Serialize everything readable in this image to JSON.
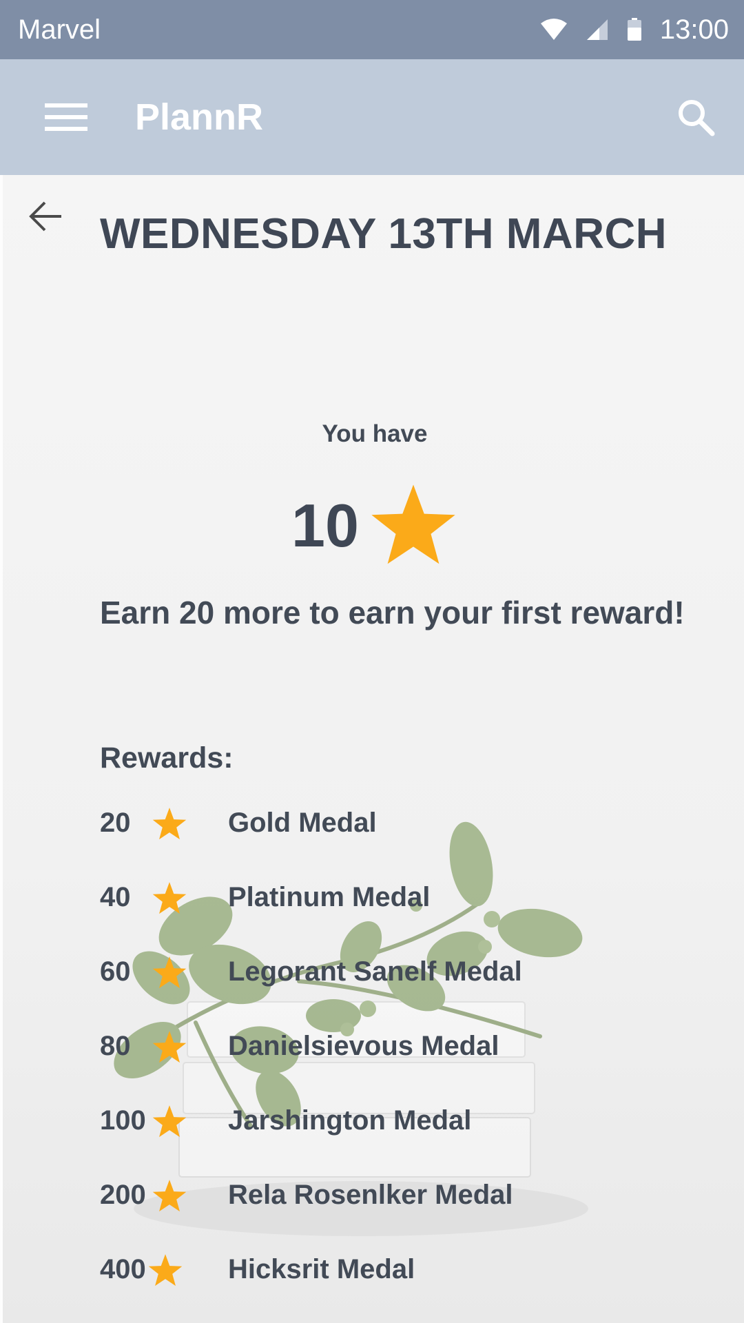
{
  "status_bar": {
    "carrier": "Marvel",
    "time": "13:00"
  },
  "app_bar": {
    "title": "PlannR",
    "menu_icon": "hamburger-menu-icon",
    "search_icon": "search-icon"
  },
  "page": {
    "back_icon": "arrow-back-icon",
    "title": "WEDNESDAY 13TH MARCH",
    "you_have": "You have",
    "stars": "10",
    "earn_more": "Earn 20 more to earn your first reward!",
    "rewards_heading": "Rewards:"
  },
  "rewards": [
    {
      "cost": "20",
      "name": "Gold Medal"
    },
    {
      "cost": "40",
      "name": "Platinum Medal"
    },
    {
      "cost": "60",
      "name": "Legorant Sanelf Medal"
    },
    {
      "cost": "80",
      "name": "Danielsievous Medal"
    },
    {
      "cost": "100",
      "name": "Jarshington Medal"
    },
    {
      "cost": "200",
      "name": "Rela Rosenlker Medal"
    },
    {
      "cost": "400",
      "name": "Hicksrit Medal"
    }
  ],
  "colors": {
    "status_bar": "#7f8ea6",
    "app_bar": "#bfcbda",
    "star": "#fbaa19",
    "text": "#424a56"
  }
}
